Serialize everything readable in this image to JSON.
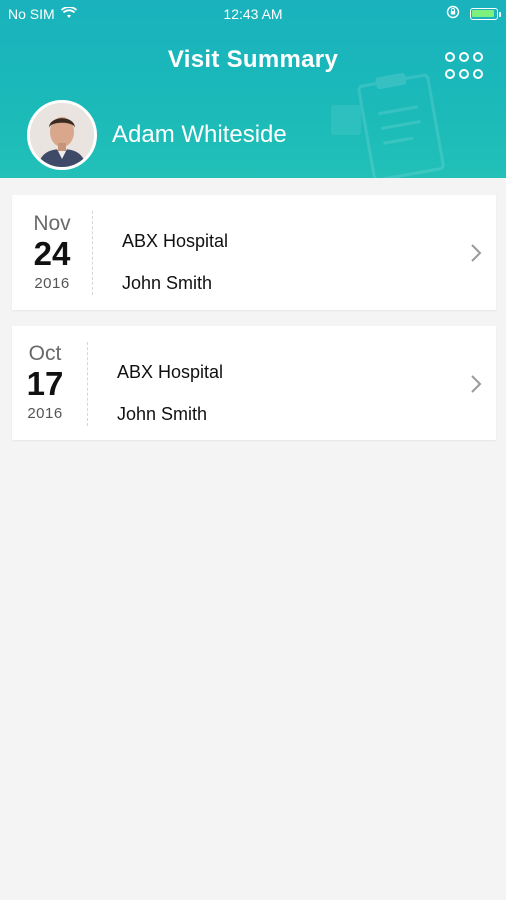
{
  "status": {
    "carrier": "No SIM",
    "time": "12:43 AM"
  },
  "header": {
    "title": "Visit Summary",
    "user_name": "Adam Whiteside"
  },
  "visits": [
    {
      "month": "Nov",
      "day": "24",
      "year": "2016",
      "hospital": "ABX Hospital",
      "doctor": "John Smith"
    },
    {
      "month": "Oct",
      "day": "17",
      "year": "2016",
      "hospital": "ABX Hospital",
      "doctor": "John Smith"
    }
  ],
  "colors": {
    "header": "#1bb6ba",
    "background": "#f4f4f4",
    "card": "#ffffff"
  },
  "icons": {
    "menu": "grid-dots-icon",
    "chevron": "chevron-right-icon",
    "wifi": "wifi-icon",
    "battery": "battery-icon",
    "lock": "orientation-lock-icon"
  }
}
